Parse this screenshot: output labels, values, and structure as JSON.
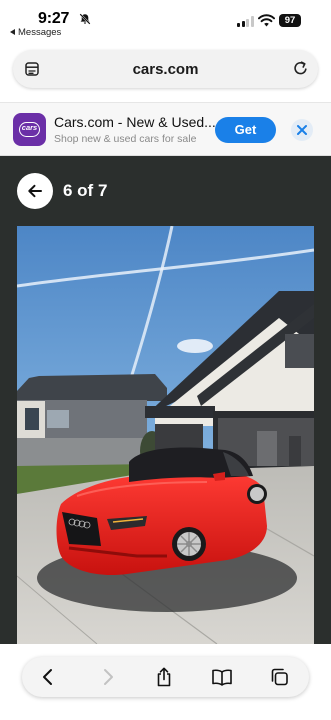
{
  "status_bar": {
    "time": "9:27",
    "back_app": "Messages",
    "battery": "97"
  },
  "browser": {
    "url": "cars.com"
  },
  "app_banner": {
    "icon_label": "cars",
    "name": "Cars.com - New & Used...",
    "subtitle": "Shop new & used cars for sale",
    "get_label": "Get"
  },
  "gallery": {
    "counter": "6 of 7"
  },
  "colors": {
    "accent": "#1a80e8",
    "app_brand": "#6b2fa7",
    "gallery_bg": "#2b2f2d",
    "car": "#e8221f"
  },
  "icons": [
    "bell-slash-icon",
    "signal-icon",
    "wifi-icon",
    "reader-icon",
    "reload-icon",
    "close-icon",
    "arrow-left-icon",
    "chevron-left-icon",
    "chevron-right-icon",
    "share-icon",
    "bookmarks-icon",
    "tabs-icon"
  ]
}
